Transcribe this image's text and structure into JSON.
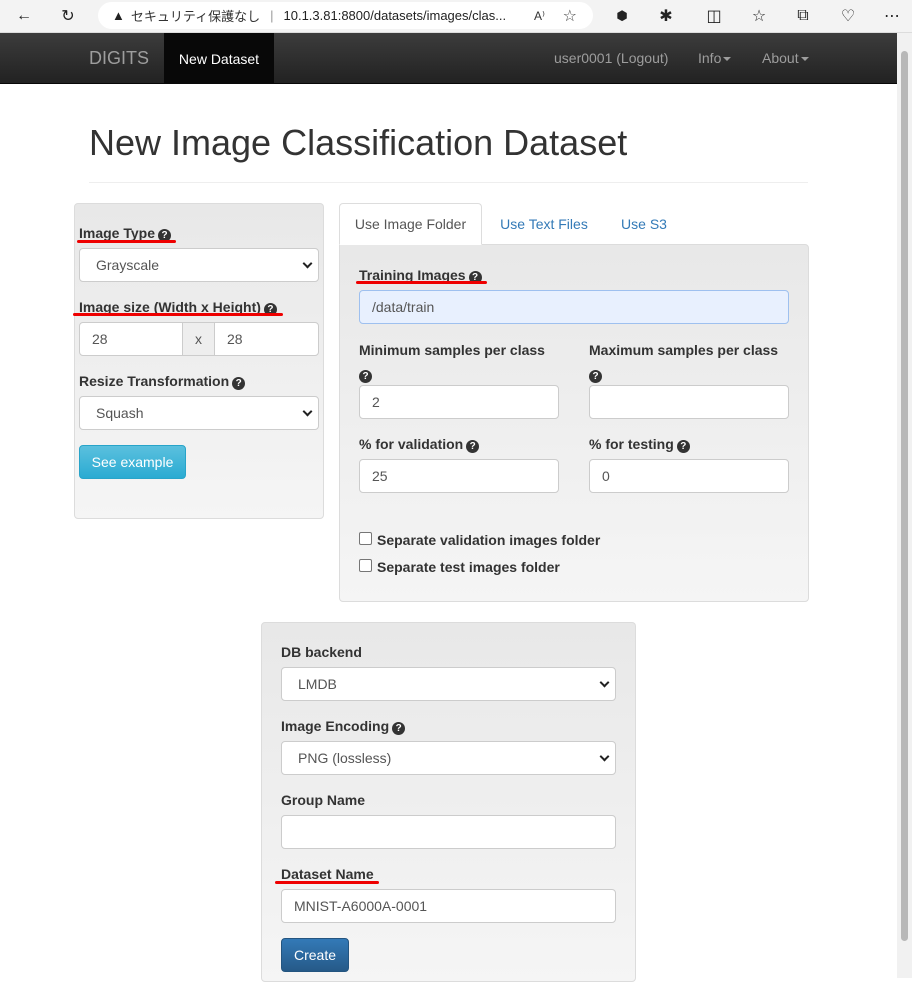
{
  "browser": {
    "security_label": "セキュリティ保護なし",
    "url": "10.1.3.81:8800/datasets/images/clas..."
  },
  "navbar": {
    "brand": "DIGITS",
    "active_tab": "New Dataset",
    "user": "user0001 (Logout)",
    "info": "Info",
    "about": "About"
  },
  "page": {
    "title": "New Image Classification Dataset"
  },
  "left_panel": {
    "image_type_label": "Image Type",
    "image_type_value": "Grayscale",
    "image_size_label": "Image size (Width x Height)",
    "width": "28",
    "x_sep": "x",
    "height": "28",
    "resize_label": "Resize Transformation",
    "resize_value": "Squash",
    "see_example": "See example"
  },
  "tabs": [
    "Use Image Folder",
    "Use Text Files",
    "Use S3"
  ],
  "image_folder": {
    "training_label": "Training Images",
    "training_value": "/data/train",
    "min_label": "Minimum samples per class",
    "min_value": "2",
    "max_label": "Maximum samples per class",
    "max_value": "",
    "val_label": "% for validation",
    "val_value": "25",
    "test_label": "% for testing",
    "test_value": "0",
    "sep_val_label": "Separate validation images folder",
    "sep_test_label": "Separate test images folder"
  },
  "bottom_panel": {
    "db_label": "DB backend",
    "db_value": "LMDB",
    "encoding_label": "Image Encoding",
    "encoding_value": "PNG (lossless)",
    "group_label": "Group Name",
    "group_value": "",
    "dataset_label": "Dataset Name",
    "dataset_value": "MNIST-A6000A-0001",
    "create": "Create"
  },
  "colors": {
    "annotation": "#e00000",
    "link": "#337ab7",
    "primary": "#337ab7",
    "info": "#5bc0de"
  }
}
